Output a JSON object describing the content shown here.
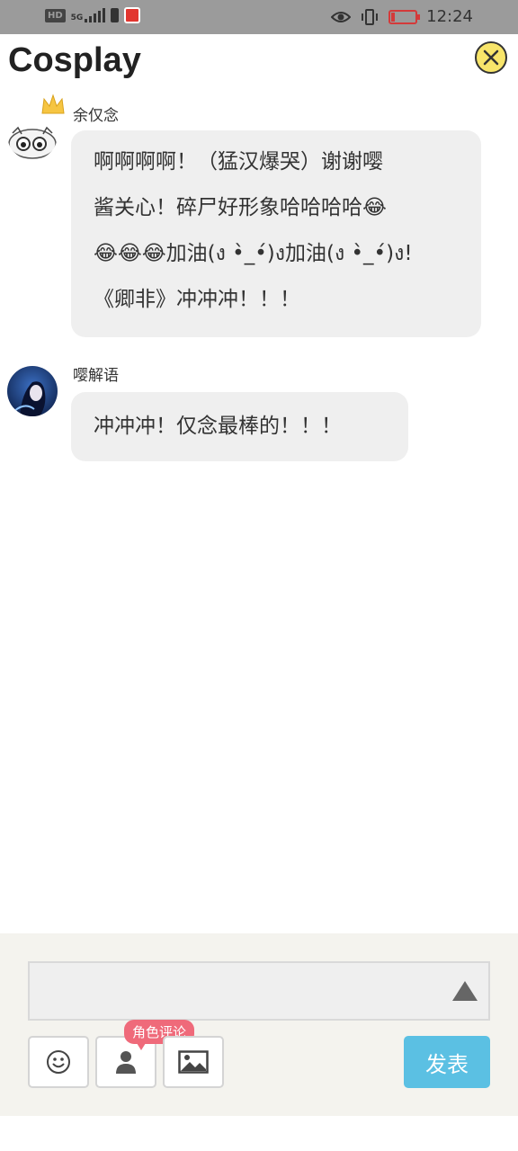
{
  "status_bar": {
    "hd_badge": "HD",
    "network_label": "5G",
    "time": "12:24"
  },
  "header": {
    "title": "Cosplay"
  },
  "messages": [
    {
      "username": "余仅念",
      "lines": [
        "啊啊啊啊！（猛汉爆哭）谢谢嘤",
        "酱关心！碎尸好形象哈哈哈哈😂",
        "😂😂😂加油(ง •̀_•́)ง加油(ง •̀_•́)ง!",
        "《卿非》冲冲冲！！！"
      ]
    },
    {
      "username": "嘤解语",
      "lines": [
        "冲冲冲！仅念最棒的！！！"
      ]
    }
  ],
  "composer": {
    "input_value": "",
    "role_comment_tag": "角色评论",
    "publish_label": "发表"
  },
  "colors": {
    "status_bar_bg": "#9b9b9b",
    "close_button": "#f8e56a",
    "bubble_bg": "#efefef",
    "composer_bg": "#f4f3ee",
    "role_tag": "#ef6a7a",
    "publish_button": "#5bc0e3"
  },
  "icons": {
    "status_left": [
      "hd-icon",
      "signal-icon",
      "battery-saver-icon",
      "book-app-icon"
    ],
    "status_right": [
      "eye-icon",
      "vibrate-icon",
      "battery-icon"
    ],
    "header": [
      "close-icon"
    ],
    "composer": [
      "send-arrow-icon",
      "emoji-icon",
      "person-icon",
      "image-icon"
    ]
  }
}
